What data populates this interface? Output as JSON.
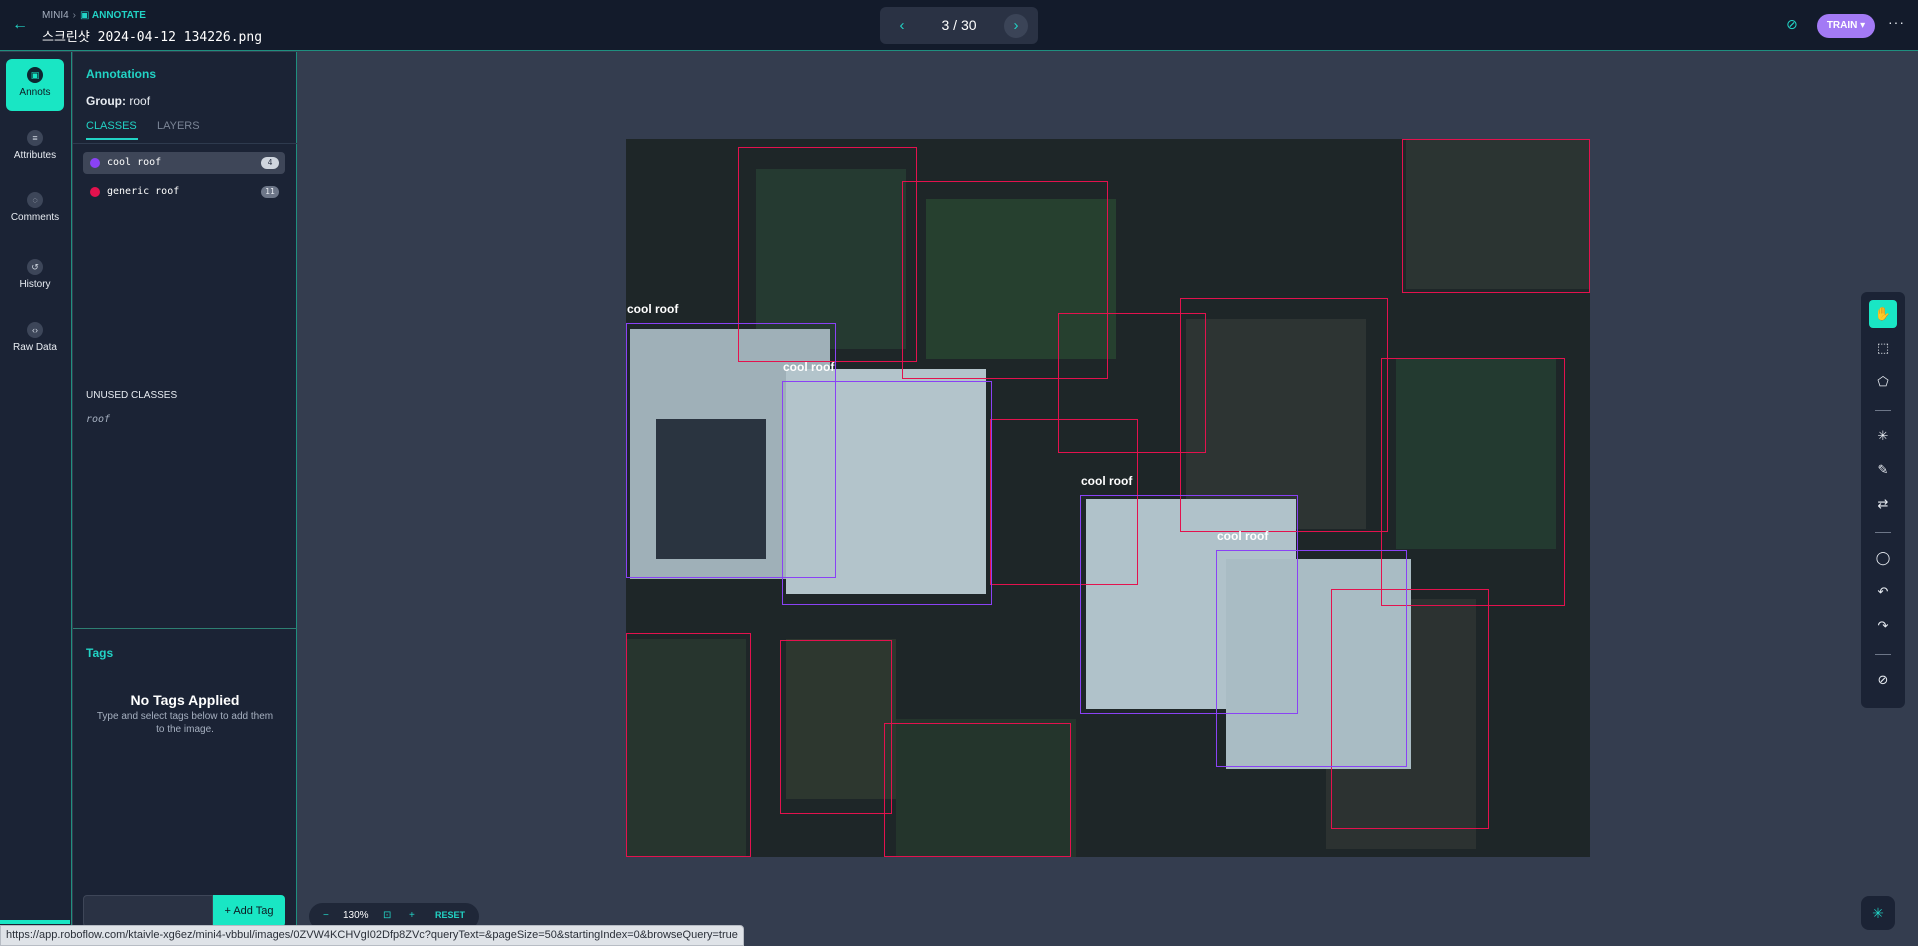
{
  "header": {
    "breadcrumb_project": "MINI4",
    "breadcrumb_sep": "›",
    "breadcrumb_mode": "ANNOTATE",
    "filename": "스크린샷 2024-04-12 134226.png",
    "pager": "3 / 30",
    "train_label": "TRAIN",
    "more": "···"
  },
  "nav": [
    {
      "label": "Annots",
      "icon": "annotations-icon"
    },
    {
      "label": "Attributes",
      "icon": "list-icon"
    },
    {
      "label": "Comments",
      "icon": "comment-icon"
    },
    {
      "label": "History",
      "icon": "history-icon"
    },
    {
      "label": "Raw Data",
      "icon": "code-icon"
    }
  ],
  "panel": {
    "title": "Annotations",
    "group_label": "Group:",
    "group_value": "roof",
    "tabs": [
      "CLASSES",
      "LAYERS"
    ],
    "classes": [
      {
        "name": "cool roof",
        "count": "4",
        "color": "#8a42f5"
      },
      {
        "name": "generic roof",
        "count": "11",
        "color": "#e3124e"
      }
    ],
    "unused_title": "UNUSED CLASSES",
    "unused": [
      "roof"
    ],
    "tags_title": "Tags",
    "no_tags": "No Tags Applied",
    "no_tags_sub": "Type and select tags below to add them to the image.",
    "add_tag": "+ Add Tag"
  },
  "zoom": {
    "minus": "−",
    "value": "130%",
    "plus": "+",
    "reset": "RESET"
  },
  "status_url": "https://app.roboflow.com/ktaivle-xg6ez/mini4-vbbul/images/0ZVW4KCHVgI02Dfp8ZVc?queryText=&pageSize=50&startingIndex=0&browseQuery=true",
  "annotations": {
    "cool_label": "cool roof",
    "boxes": [
      {
        "cls": "cool",
        "label": true
      },
      {
        "cls": "cool",
        "label": true
      },
      {
        "cls": "cool",
        "label": true
      },
      {
        "cls": "cool",
        "label": true
      }
    ]
  },
  "colors": {
    "accent": "#19e6c4",
    "cool_roof": "#8a42f5",
    "generic_roof": "#e3124e",
    "train": "#a37af5"
  }
}
